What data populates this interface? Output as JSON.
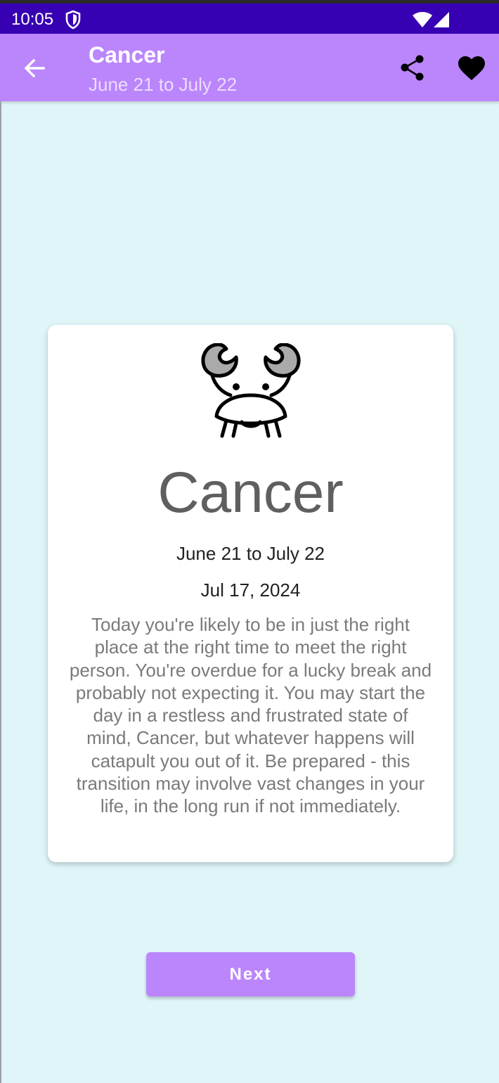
{
  "status_bar": {
    "time": "10:05",
    "icons": [
      "shield-icon",
      "wifi-icon",
      "signal-icon"
    ],
    "color": "#3700b3"
  },
  "app_bar": {
    "title": "Cancer",
    "subtitle": "June 21 to July 22",
    "back_icon": "arrow-back-icon",
    "share_icon": "share-icon",
    "favorite_icon": "heart-icon",
    "color": "#bb86fc"
  },
  "card": {
    "image_icon": "cancer-crab-icon",
    "title": "Cancer",
    "date_range": "June 21 to July 22",
    "date": "Jul 17, 2024",
    "horoscope": "Today you're likely to be in just the right place at the right time to meet the right person. You're overdue for a lucky break and probably not expecting it. You may start the day in a restless and frustrated state of mind, Cancer, but whatever happens will catapult you out of it. Be prepared - this transition may involve vast changes in your life, in the long run if not immediately."
  },
  "next_button": {
    "label": "Next",
    "color": "#bb86fc"
  },
  "background_color": "#dff5f8"
}
